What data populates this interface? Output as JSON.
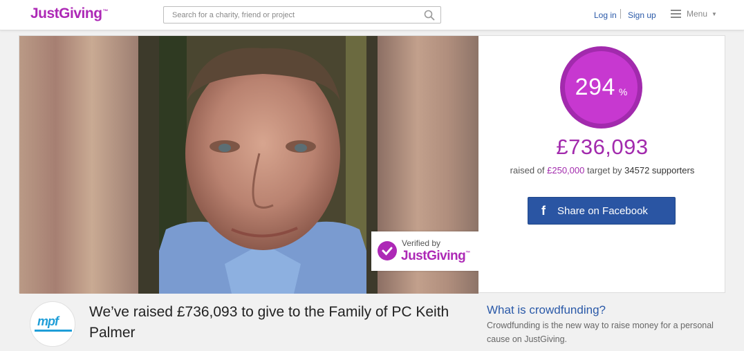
{
  "header": {
    "logo_text": "JustGiving",
    "logo_tm": "™",
    "search_placeholder": "Search for a charity, friend or project",
    "login_label": "Log in",
    "signup_label": "Sign up",
    "menu_label": "Menu"
  },
  "hero": {
    "badge_by": "Verified by",
    "badge_brand": "JustGiving"
  },
  "stats": {
    "percent": "294",
    "percent_sign": "%",
    "raised": "£736,093",
    "raised_prefix": "raised of ",
    "target": "£250,000",
    "target_mid": " target by ",
    "supporters": "34572 supporters"
  },
  "share": {
    "facebook_label": "Share on Facebook"
  },
  "page": {
    "avatar_text": "mpf",
    "headline": "We’ve raised £736,093 to give to the Family of PC Keith Palmer"
  },
  "crowdfunding": {
    "title": "What is crowdfunding?",
    "text": "Crowdfunding is the new way to raise money for a personal cause on JustGiving."
  },
  "colors": {
    "brand": "#ad29b6",
    "link": "#2a59a8",
    "facebook": "#2a55a3"
  }
}
